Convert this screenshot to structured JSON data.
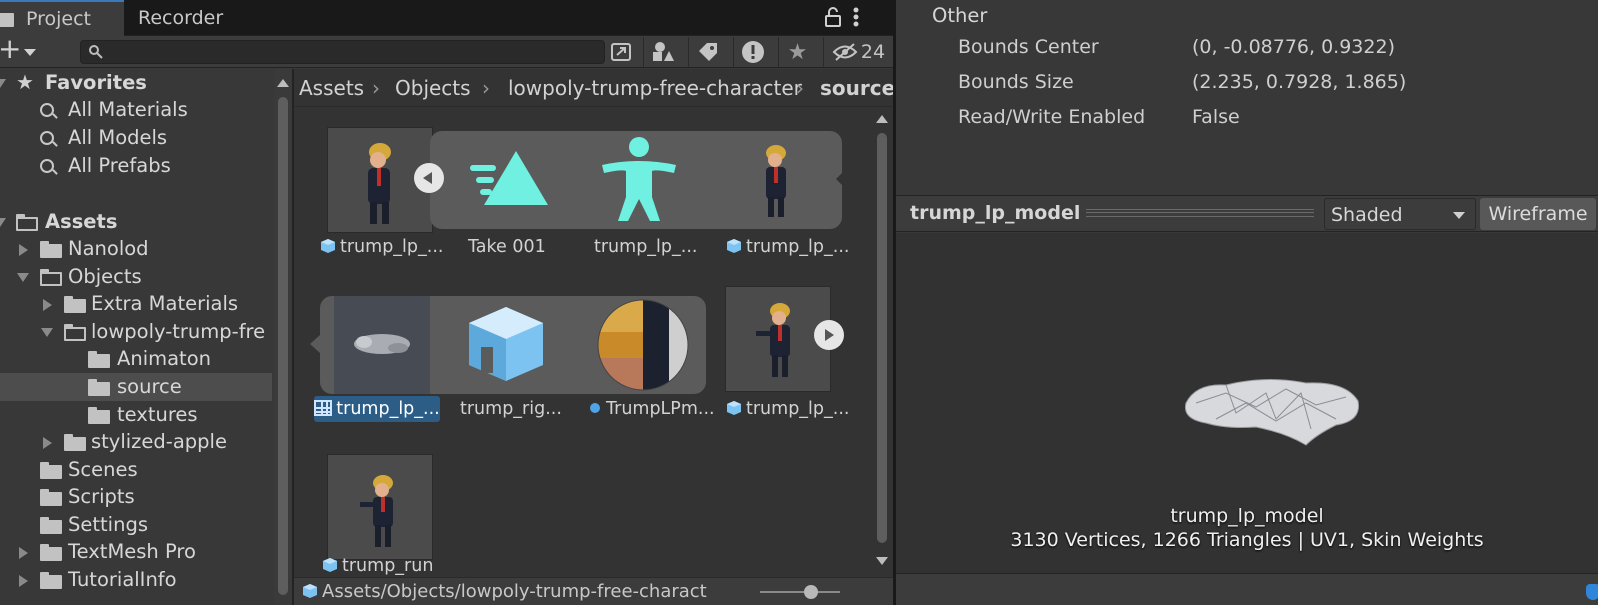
{
  "tabs": {
    "project": "Project",
    "recorder": "Recorder"
  },
  "toolbar": {
    "add": "+",
    "search_placeholder": "",
    "hidden_count": "24"
  },
  "tree": {
    "favorites": "Favorites",
    "fav_items": [
      "All Materials",
      "All Models",
      "All Prefabs"
    ],
    "assets": "Assets",
    "items": [
      "Nanolod",
      "Objects",
      "Extra Materials",
      "lowpoly-trump-fre",
      "Animaton",
      "source",
      "textures",
      "stylized-apple",
      "Scenes",
      "Scripts",
      "Settings",
      "TextMesh Pro",
      "TutorialInfo"
    ]
  },
  "breadcrumb": [
    "Assets",
    "Objects",
    "lowpoly-trump-free-character",
    "source"
  ],
  "grid": {
    "labels": [
      "trump_lp_...",
      "Take 001",
      "trump_lp_...",
      "trump_lp_...",
      "trump_lp_...",
      "trump_rig...",
      "TrumpLPm...",
      "trump_lp_...",
      "trump_run"
    ]
  },
  "pathbar": "Assets/Objects/lowpoly-trump-free-charact",
  "inspector": {
    "section": "Other",
    "props": [
      {
        "label": "Bounds Center",
        "value": "(0, -0.08776, 0.9322)"
      },
      {
        "label": "Bounds Size",
        "value": "(2.235, 0.7928, 1.865)"
      },
      {
        "label": "Read/Write Enabled",
        "value": "False"
      }
    ],
    "preview_title": "trump_lp_model",
    "shading": "Shaded",
    "wireframe": "Wireframe",
    "caption_name": "trump_lp_model",
    "caption_stats": "3130 Vertices, 1266 Triangles | UV1, Skin Weights"
  },
  "colors": {
    "accent": "#3a79bb",
    "selection": "#2c5d87",
    "icon_teal": "#6ff0e0",
    "icon_blue": "#7cc3f2"
  }
}
